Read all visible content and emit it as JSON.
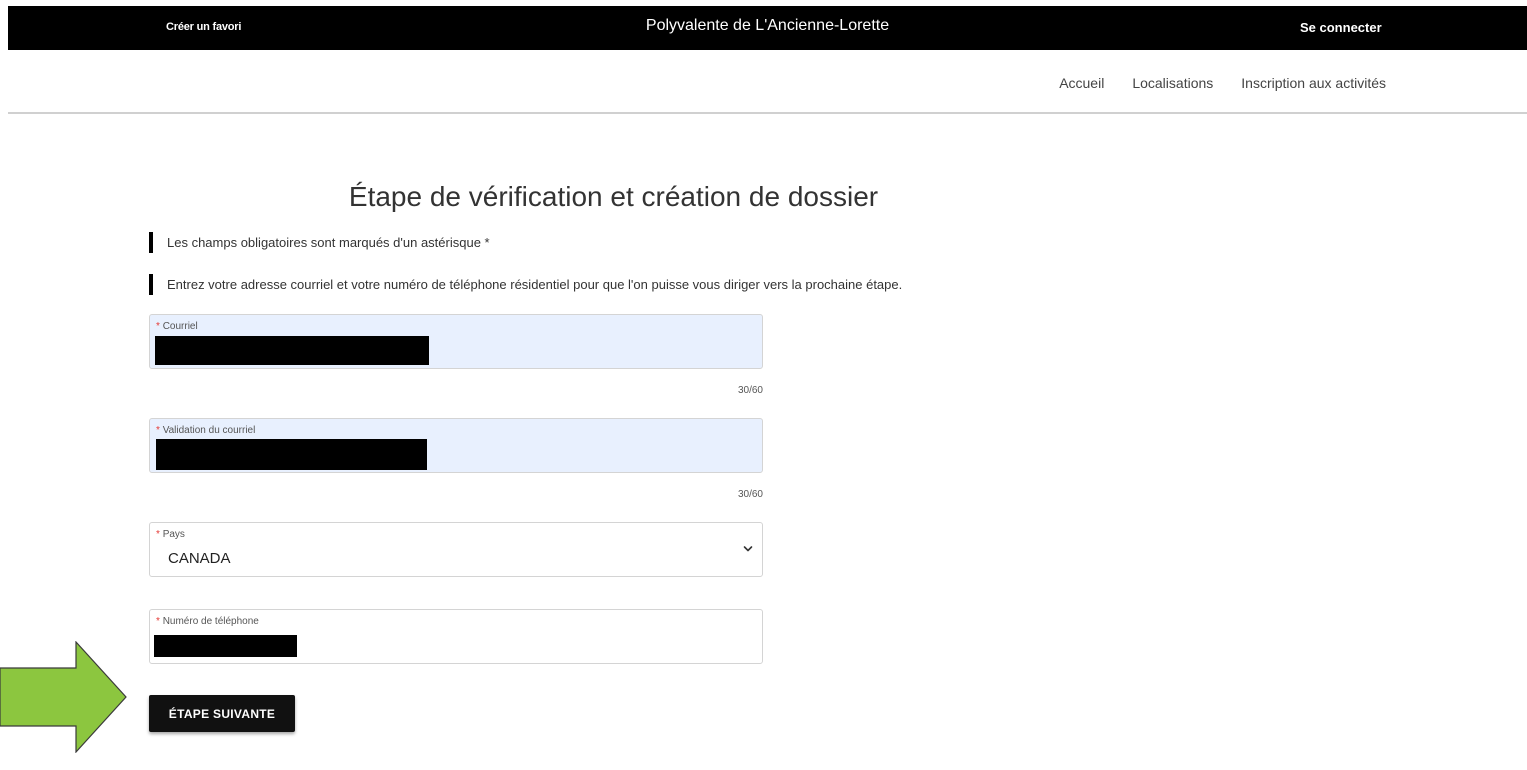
{
  "header": {
    "bookmark_label": "Créer un favori",
    "site_title": "Polyvalente de L'Ancienne-Lorette",
    "login_label": "Se connecter"
  },
  "nav": {
    "items": [
      "Accueil",
      "Localisations",
      "Inscription aux activités"
    ]
  },
  "page": {
    "title": "Étape de vérification et création de dossier",
    "notice_required": "Les champs obligatoires sont marqués d'un astérisque *",
    "notice_instructions": "Entrez votre adresse courriel et votre numéro de téléphone résidentiel pour que l'on puisse vous diriger vers la prochaine étape."
  },
  "form": {
    "required_mark": "*",
    "email": {
      "label": "Courriel",
      "counter": "30/60"
    },
    "email_confirm": {
      "label": "Validation du courriel",
      "counter": "30/60"
    },
    "country": {
      "label": "Pays",
      "value": "CANADA"
    },
    "phone": {
      "label": "Numéro de téléphone"
    },
    "next_label": "ÉTAPE SUIVANTE"
  },
  "colors": {
    "topbar": "#000000",
    "autofill_bg": "#e8f0fe",
    "required": "#e53935",
    "arrow_fill": "#8cc63f"
  },
  "icons": {
    "select": "chevron-down-icon",
    "annotation": "arrow-right-icon"
  }
}
